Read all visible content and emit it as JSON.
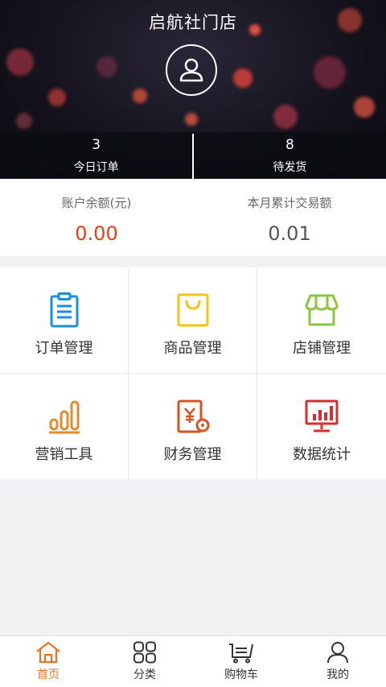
{
  "header": {
    "store_name": "启航社门店",
    "stats": [
      {
        "value": "3",
        "label": "今日订单"
      },
      {
        "value": "8",
        "label": "待发货"
      }
    ]
  },
  "balance": {
    "account_label": "账户余额(元)",
    "account_value": "0.00",
    "monthly_label": "本月累计交易额",
    "monthly_value": "0.01"
  },
  "grid": [
    {
      "label": "订单管理",
      "icon": "clipboard-icon",
      "color": "#1e8fd6"
    },
    {
      "label": "商品管理",
      "icon": "shopping-bag-icon",
      "color": "#f2c318"
    },
    {
      "label": "店铺管理",
      "icon": "storefront-icon",
      "color": "#8cc63f"
    },
    {
      "label": "营销工具",
      "icon": "bar-chart-icon",
      "color": "#e68a2e"
    },
    {
      "label": "财务管理",
      "icon": "finance-icon",
      "color": "#d9531e"
    },
    {
      "label": "数据统计",
      "icon": "monitor-chart-icon",
      "color": "#d32f2f"
    }
  ],
  "tabs": [
    {
      "label": "首页",
      "icon": "home-icon",
      "active": true
    },
    {
      "label": "分类",
      "icon": "grid-icon",
      "active": false
    },
    {
      "label": "购物车",
      "icon": "cart-icon",
      "active": false
    },
    {
      "label": "我的",
      "icon": "user-icon",
      "active": false
    }
  ],
  "colors": {
    "accent": "#f0701f",
    "balance_red": "#f03c13"
  }
}
